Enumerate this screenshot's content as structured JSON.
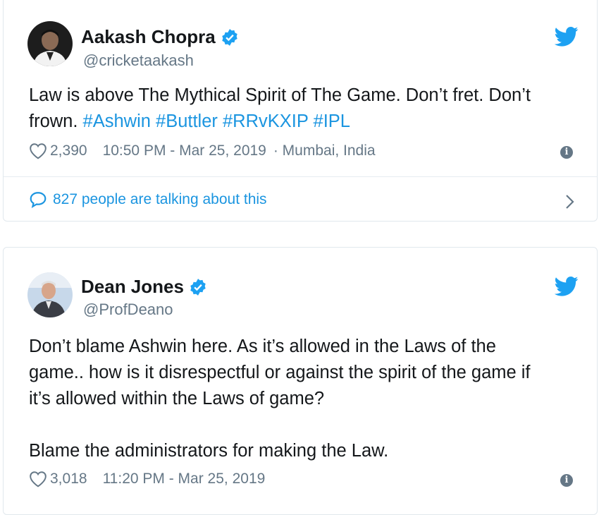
{
  "tweets": [
    {
      "name": "Aakash Chopra",
      "handle": "@cricketaakash",
      "text_plain": "Law is above The Mythical Spirit of The Game. Don’t fret. Don’t\nfrown. ",
      "hashtags": [
        "#Ashwin",
        "#Buttler",
        "#RRvKXIP",
        "#IPL"
      ],
      "likes": "2,390",
      "timestamp": "10:50 PM - Mar 25, 2019",
      "location": "· Mumbai, India",
      "talking": "827 people are talking about this"
    },
    {
      "name": "Dean Jones",
      "handle": "@ProfDeano",
      "text_plain": "Don’t blame Ashwin here. As it’s allowed in the Laws of the\ngame.. how is it disrespectful or against the  spirit of the game if\nit’s allowed within the Laws of game?\n\nBlame the administrators for making the Law.",
      "likes": "3,018",
      "timestamp": "11:20 PM - Mar 25, 2019"
    }
  ],
  "colors": {
    "link": "#1b95e0",
    "secondary": "#657786",
    "verified": "#1da1f2"
  },
  "icons": [
    "verified-badge-icon",
    "twitter-bird-icon",
    "heart-icon",
    "info-icon",
    "speech-bubble-icon",
    "chevron-right-icon"
  ]
}
